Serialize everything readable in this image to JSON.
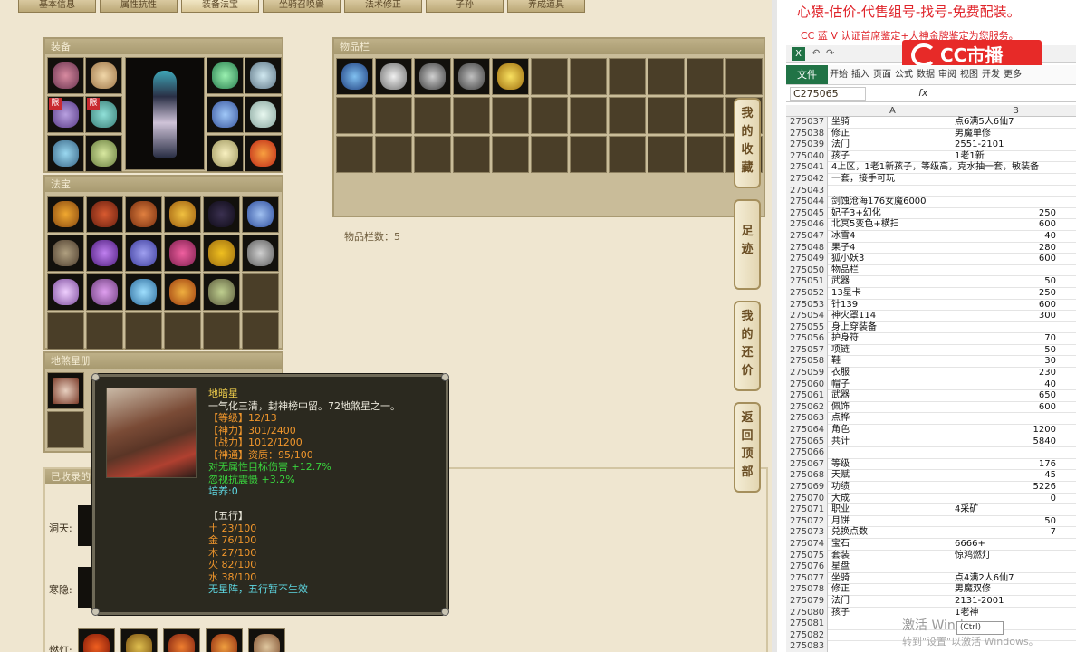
{
  "game": {
    "top_tabs": [
      "基本信息",
      "属性抗性",
      "装备法宝",
      "坐骑召唤兽",
      "法术修正",
      "子孙",
      "养成道具"
    ],
    "equip_panel": {
      "title": "装备",
      "limit_tag": "限"
    },
    "fabao_panel": {
      "title": "法宝"
    },
    "dishaxing_panel": {
      "title": "地煞星册"
    },
    "bag_panel": {
      "title": "物品栏",
      "count_label": "物品栏数：5"
    },
    "collected_label": "已收录的",
    "rows": [
      {
        "label": "洞天:"
      },
      {
        "label": "寒隐:"
      },
      {
        "label": "燃灯:"
      }
    ],
    "side_tabs": [
      {
        "chars": [
          "我",
          "的",
          "收",
          "藏"
        ]
      },
      {
        "chars": [
          "足",
          "迹"
        ]
      },
      {
        "chars": [
          "我",
          "的",
          "还",
          "价"
        ]
      },
      {
        "chars": [
          "返",
          "回",
          "顶",
          "部"
        ]
      }
    ],
    "tooltip": {
      "name": "地暗星",
      "desc": "一气化三清，封神榜中留。72地煞星之一。",
      "level": "【等级】12/13",
      "shenli": "【神力】301/2400",
      "zhanli": "【战力】1012/1200",
      "shentong": "【神通】资质：95/100",
      "bonus1": "对无属性目标伤害 +12.7%",
      "bonus2": "忽视抗震慑 +3.2%",
      "peiyang": "培养:0",
      "wuxing_title": "【五行】",
      "wuxing": [
        "土 23/100",
        "金 76/100",
        "木 27/100",
        "火 82/100",
        "水 38/100"
      ],
      "no_star": "无星阵，五行暂不生效"
    }
  },
  "sheet": {
    "banner1": "心猿-估价-代售组号-找号-免费配装。",
    "banner2": "CC 蓝 V 认证首席鉴定+大神金牌鉴定为您服务。",
    "logo": "CC市播",
    "ribbon": {
      "file": "文件",
      "tabs": [
        "开始",
        "插入",
        "页面",
        "公式",
        "数据",
        "审阅",
        "视图",
        "开发",
        "更多"
      ]
    },
    "name_box": "C275065",
    "fx": "fx",
    "col_a": "A",
    "col_b": "B",
    "rows": [
      [
        "275037",
        "坐骑",
        "点6满5人6仙7"
      ],
      [
        "275038",
        "修正",
        "男魔单修"
      ],
      [
        "275039",
        "法门",
        "2551-2101"
      ],
      [
        "275040",
        "孩子",
        "1老1新"
      ],
      [
        "275041",
        "4上区，1老1新孩子，等级高，克水抽一套，敏装备",
        ""
      ],
      [
        "275042",
        "一套，接手可玩",
        ""
      ],
      [
        "275043",
        "",
        ""
      ],
      [
        "275044",
        "剑蚀沧海176女魔6000",
        ""
      ],
      [
        "275045",
        "妃子3+幻化",
        "250"
      ],
      [
        "275046",
        "北冥5变色+横扫",
        "600"
      ],
      [
        "275047",
        "冰雪4",
        "40"
      ],
      [
        "275048",
        "果子4",
        "280"
      ],
      [
        "275049",
        "狐小妖3",
        "600"
      ],
      [
        "275050",
        "物品栏",
        ""
      ],
      [
        "275051",
        "武器",
        "50"
      ],
      [
        "275052",
        "13星卡",
        "250"
      ],
      [
        "275053",
        "针139",
        "600"
      ],
      [
        "275054",
        "神火罩114",
        "300"
      ],
      [
        "275055",
        "身上穿装备",
        ""
      ],
      [
        "275056",
        "护身符",
        "70"
      ],
      [
        "275057",
        "项链",
        "50"
      ],
      [
        "275058",
        "鞋",
        "30"
      ],
      [
        "275059",
        "衣服",
        "230"
      ],
      [
        "275060",
        "帽子",
        "40"
      ],
      [
        "275061",
        "武器",
        "650"
      ],
      [
        "275062",
        "佩饰",
        "600"
      ],
      [
        "275063",
        "点桦",
        ""
      ],
      [
        "275064",
        "角色",
        "1200"
      ],
      [
        "275065",
        "共计",
        "5840"
      ],
      [
        "275066",
        "",
        ""
      ],
      [
        "275067",
        "等级",
        "176"
      ],
      [
        "275068",
        "天赋",
        "45"
      ],
      [
        "275069",
        "功绩",
        "5226"
      ],
      [
        "275070",
        "大成",
        "0"
      ],
      [
        "275071",
        "职业",
        "4采矿"
      ],
      [
        "275072",
        "月饼",
        "50"
      ],
      [
        "275073",
        "兑换点数",
        "7"
      ],
      [
        "275074",
        "宝石",
        "6666+"
      ],
      [
        "275075",
        "套装",
        "惊鸿燃灯"
      ],
      [
        "275076",
        "星盘",
        ""
      ],
      [
        "275077",
        "坐骑",
        "点4满2人6仙7"
      ],
      [
        "275078",
        "修正",
        "男魔双修"
      ],
      [
        "275079",
        "法门",
        "2131-2001"
      ],
      [
        "275080",
        "孩子",
        "1老神"
      ],
      [
        "275081",
        "",
        ""
      ],
      [
        "275082",
        "",
        ""
      ],
      [
        "275083",
        "",
        ""
      ]
    ],
    "watermark": "激活 Windows",
    "watermark2": "转到\"设置\"以激活 Windows。",
    "ctrl_popup": "(Ctrl)"
  },
  "colors": {
    "panel_bg": "#c9bc99",
    "slot_bg": "#4a3e28",
    "tooltip_bg": "#2b291f",
    "gold": "#e9c84a",
    "green": "#39d33d",
    "cyan": "#5ed7e2",
    "excel_green": "#217346",
    "banner_red": "#e0252b"
  }
}
